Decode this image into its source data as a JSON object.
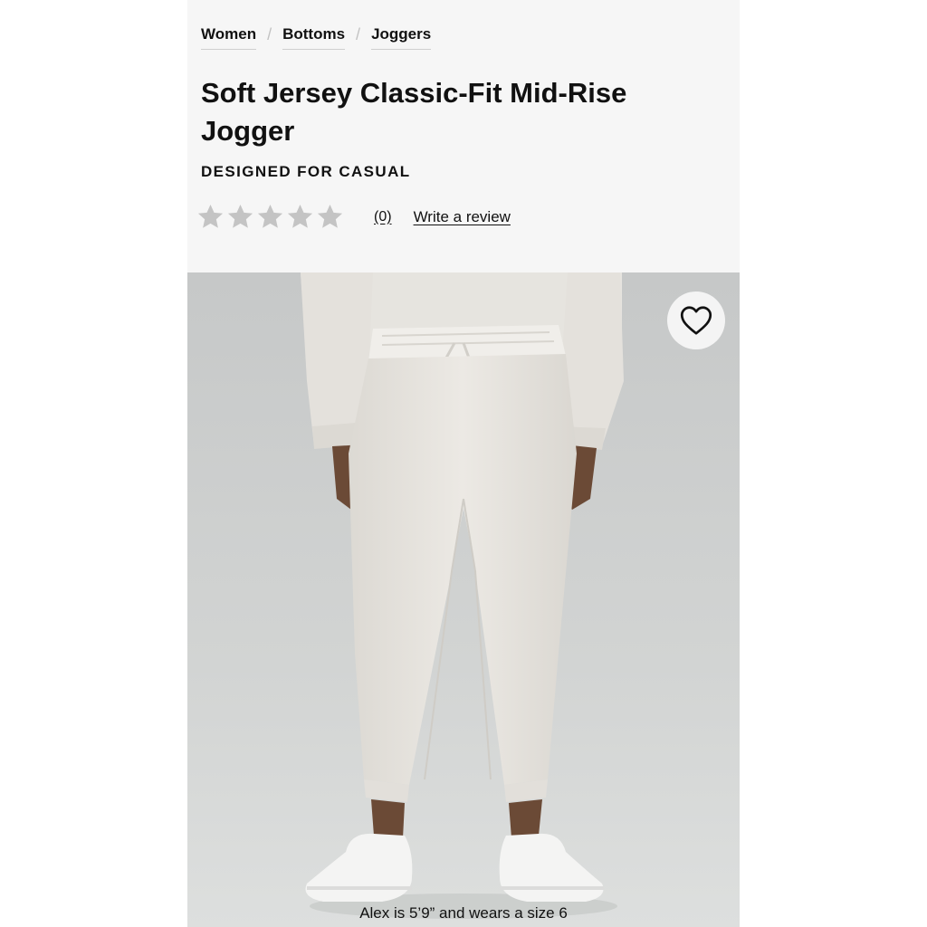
{
  "breadcrumb": {
    "items": [
      "Women",
      "Bottoms",
      "Joggers"
    ],
    "separator": "/"
  },
  "product": {
    "title": "Soft Jersey Classic-Fit Mid-Rise Jogger",
    "subtitle": "DESIGNED FOR CASUAL",
    "rating": {
      "stars_filled": 0,
      "stars_total": 5,
      "count_label": "(0)",
      "write_review_label": "Write a review"
    },
    "image": {
      "caption": "Alex is 5’9” and wears a size 6",
      "wishlist_icon": "heart-icon"
    }
  },
  "colors": {
    "text": "#111111",
    "star_empty": "#c4c4c4",
    "background": "#f6f6f6",
    "photo_bg": "#cfd1d1",
    "garment": "#e9e6e1"
  }
}
